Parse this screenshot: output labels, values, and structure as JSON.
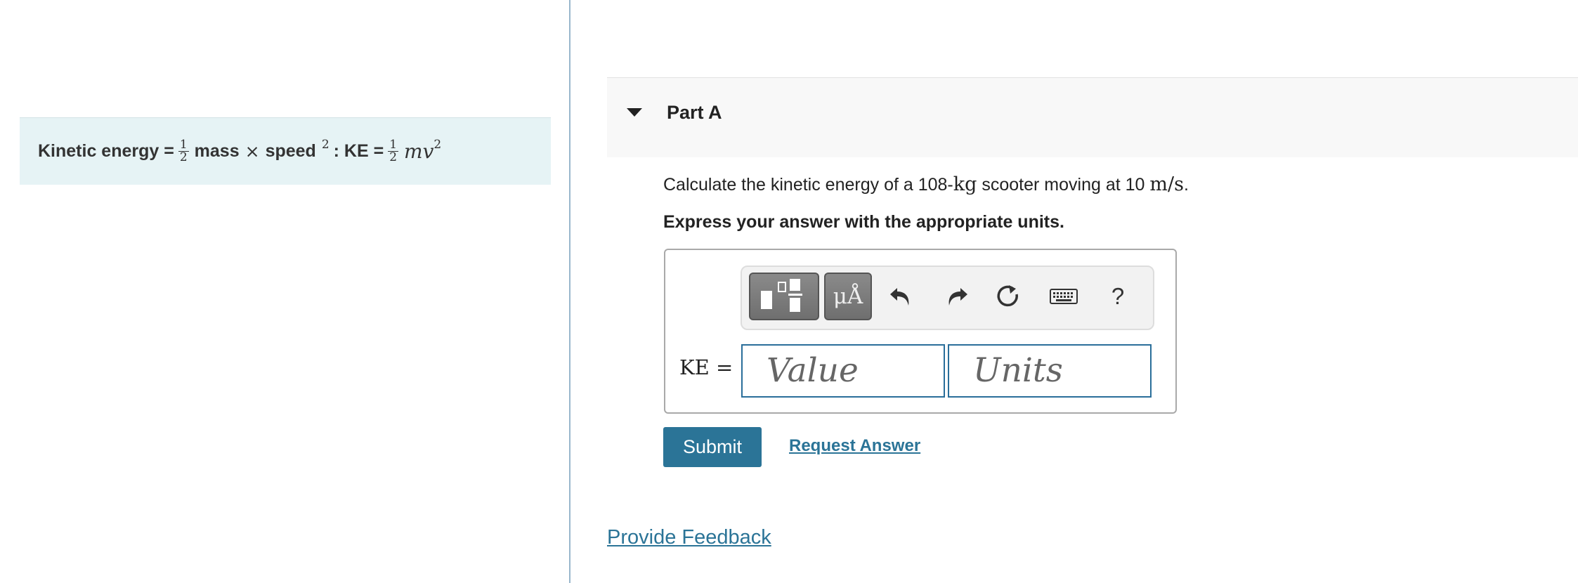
{
  "hint": {
    "label": "Kinetic energy =",
    "frac_num": "1",
    "frac_den": "2",
    "mass": "mass",
    "times": "×",
    "speed": "speed",
    "exp": "2",
    "sep": ": KE =",
    "frac2_num": "1",
    "frac2_den": "2",
    "mv": "mv",
    "mv_exp": "2"
  },
  "part": {
    "title": "Part A"
  },
  "question": {
    "text_1": "Calculate the kinetic energy of a 108-",
    "unit_kg": "kg",
    "text_2": " scooter moving at 10 ",
    "unit_ms": "m/s",
    "text_3": ".",
    "instruction": "Express your answer with the appropriate units."
  },
  "toolbar": {
    "units_label": "μÅ",
    "help_label": "?",
    "icons": [
      "templates-icon",
      "units-icon",
      "undo-icon",
      "redo-icon",
      "reset-icon",
      "keyboard-icon",
      "help-icon"
    ]
  },
  "answer": {
    "label": "KE =",
    "value_placeholder": "Value",
    "units_placeholder": "Units"
  },
  "actions": {
    "submit_label": "Submit",
    "request_label": "Request Answer",
    "feedback_label": "Provide Feedback"
  },
  "colors": {
    "accent": "#2b7497",
    "hint_bg": "#e6f3f5",
    "header_bg": "#f8f8f8",
    "divider": "#9ab7cc"
  }
}
